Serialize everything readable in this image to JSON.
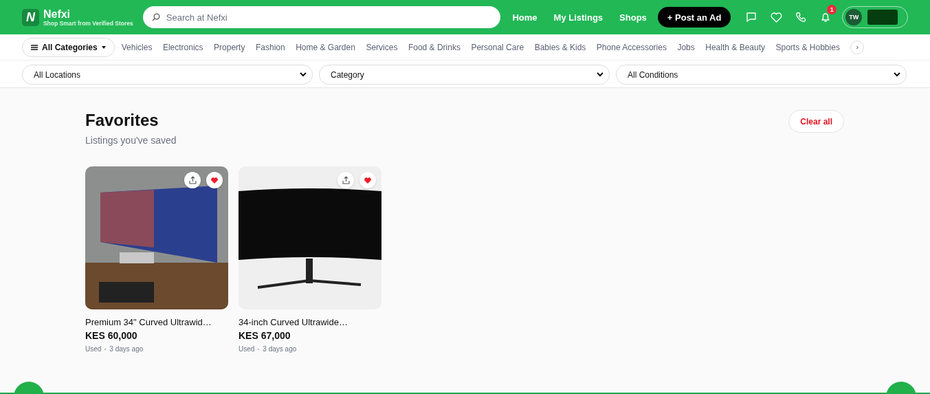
{
  "header": {
    "logo_letter": "N",
    "brand": "Nefxi",
    "tagline": "Shop Smart from Verified Stores",
    "search": {
      "placeholder": "Search at Nefxi"
    },
    "nav": [
      {
        "label": "Home"
      },
      {
        "label": "My Listings"
      },
      {
        "label": "Shops"
      }
    ],
    "post_button": "+ Post an Ad",
    "notification_count": "1",
    "avatar_initials": "TW"
  },
  "categories": {
    "all_button": "All Categories",
    "items": [
      "Vehicles",
      "Electronics",
      "Property",
      "Fashion",
      "Home & Garden",
      "Services",
      "Food & Drinks",
      "Personal Care",
      "Babies & Kids",
      "Phone Accessories",
      "Jobs",
      "Health & Beauty",
      "Sports & Hobbies"
    ],
    "next_button": "›"
  },
  "filters": [
    {
      "value": "All Locations"
    },
    {
      "value": "Category"
    },
    {
      "value": "All Conditions"
    }
  ],
  "favorites": {
    "title": "Favorites",
    "subtitle": "Listings you've saved",
    "clear_button": "Clear all",
    "listings": [
      {
        "title": "Premium 34\" Curved Ultrawid…",
        "price": "KES 60,000",
        "condition": "Used",
        "posted": "3 days ago",
        "favorited": true
      },
      {
        "title": "34-inch Curved Ultrawide…",
        "price": "KES 67,000",
        "condition": "Used",
        "posted": "3 days ago",
        "favorited": true
      }
    ]
  }
}
